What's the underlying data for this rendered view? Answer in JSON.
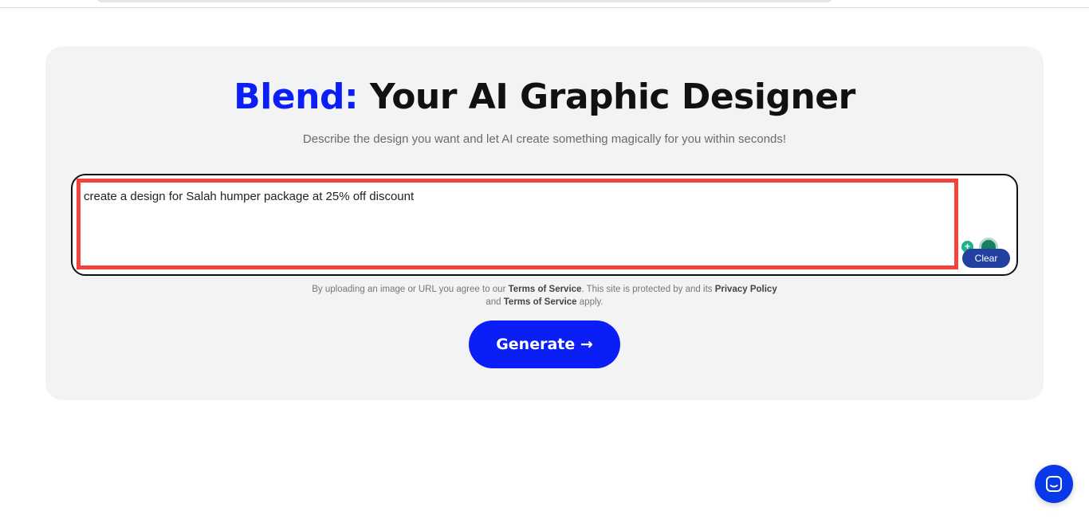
{
  "header": {
    "brand": "Blend:",
    "title": "Your AI Graphic Designer",
    "subtitle": "Describe the design you want and let AI create something magically for you within seconds!"
  },
  "prompt": {
    "value": "create a design for Salah humper package at 25% off discount",
    "clear_label": "Clear"
  },
  "extension_icons": [
    "plus-icon",
    "grammarly-icon"
  ],
  "legal": {
    "part1": "By uploading an image or URL you agree to our ",
    "terms1": "Terms of Service",
    "part2": ". This site is protected by and its ",
    "privacy": "Privacy Policy",
    "part3": " and ",
    "terms2": "Terms of Service",
    "part4": " apply."
  },
  "generate": {
    "label": "Generate →"
  },
  "colors": {
    "accent": "#0a1ef5",
    "card_bg": "#f2f3f5",
    "highlight": "#f0443c",
    "clear_bg": "#2041a0"
  },
  "chat": {
    "icon": "chat-icon"
  }
}
